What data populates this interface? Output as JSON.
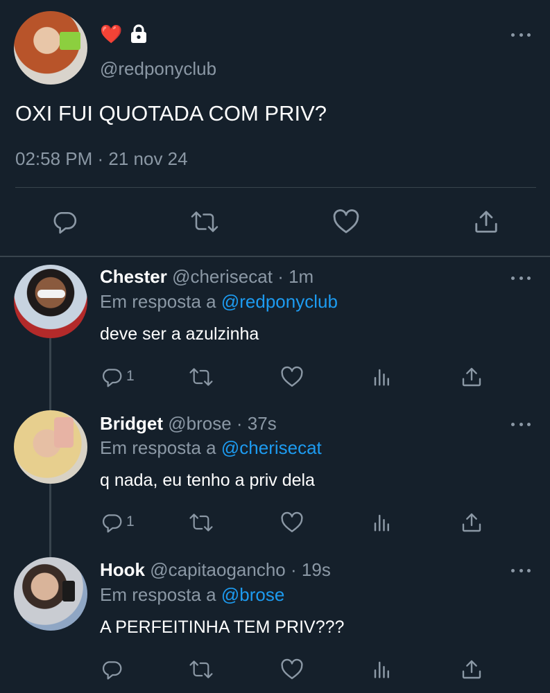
{
  "main_tweet": {
    "badge_emoji": "❤️",
    "handle": "@redponyclub",
    "text": "OXI FUI QUOTADA COM PRIV?",
    "timestamp": "02:58 PM · 21 nov 24"
  },
  "replies": [
    {
      "name": "Chester",
      "handle": "@cherisecat",
      "time": "· 1m",
      "reply_prefix": "Em resposta a",
      "reply_to": "@redponyclub",
      "text": "deve ser a azulzinha",
      "reply_count": "1"
    },
    {
      "name": "Bridget",
      "handle": "@brose",
      "time": "· 37s",
      "reply_prefix": "Em resposta a",
      "reply_to": "@cherisecat",
      "text": "q nada, eu tenho a priv dela",
      "reply_count": "1"
    },
    {
      "name": "Hook",
      "handle": "@capitaogancho",
      "time": "· 19s",
      "reply_prefix": "Em resposta a",
      "reply_to": "@brose",
      "text": "A PERFEITINHA TEM PRIV???",
      "reply_count": ""
    }
  ],
  "colors": {
    "background": "#15202b",
    "muted": "#8b98a5",
    "link": "#1d9bf0",
    "divider": "#38444d",
    "heart": "#e0245e"
  },
  "icons": [
    "reply-icon",
    "retweet-icon",
    "like-icon",
    "share-icon",
    "analytics-icon",
    "lock-icon",
    "more-icon"
  ]
}
